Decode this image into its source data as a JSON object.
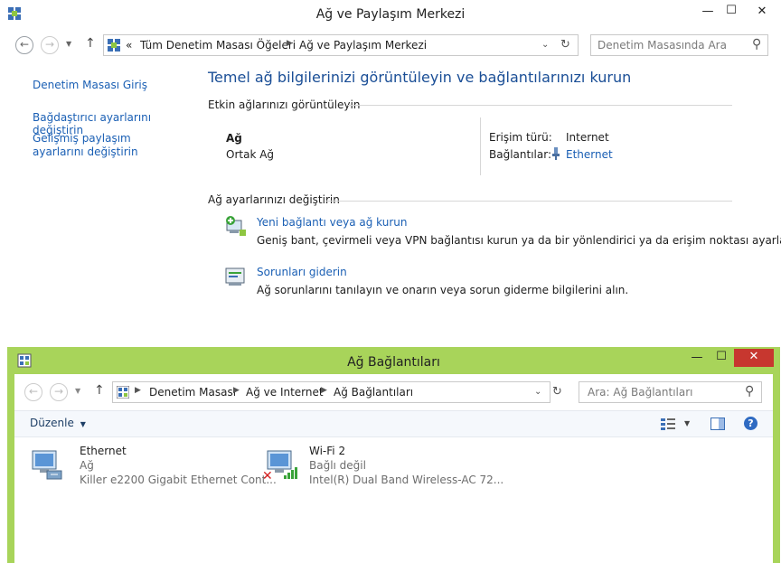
{
  "window1": {
    "title": "Ağ ve Paylaşım Merkezi",
    "controls": {
      "minimize": "—",
      "maximize": "☐",
      "close": "✕"
    },
    "breadcrumb": {
      "overflow": "«",
      "items": [
        "Tüm Denetim Masası Öğeleri",
        "Ağ ve Paylaşım Merkezi"
      ]
    },
    "search_placeholder": "Denetim Masasında Ara",
    "sidebar": {
      "home": "Denetim Masası Giriş",
      "items": [
        "Bağdaştırıcı ayarlarını değiştirin",
        "Gelişmiş paylaşım ayarlarını değiştirin"
      ]
    },
    "main": {
      "heading": "Temel ağ bilgilerinizi görüntüleyin ve bağlantılarınızı kurun",
      "active_section": "Etkin ağlarınızı görüntüleyin",
      "network_name": "Ağ",
      "network_type": "Ortak Ağ",
      "access_label": "Erişim türü:",
      "access_value": "Internet",
      "connections_label": "Bağlantılar:",
      "connections_value": "Ethernet",
      "change_section": "Ağ ayarlarınızı değiştirin",
      "tasks": [
        {
          "title": "Yeni bağlantı veya ağ kurun",
          "desc": "Geniş bant, çevirmeli veya VPN bağlantısı kurun ya da bir yönlendirici ya da erişim noktası ayarlayın."
        },
        {
          "title": "Sorunları giderin",
          "desc": "Ağ sorunlarını tanılayın ve onarın veya sorun giderme bilgilerini alın."
        }
      ]
    }
  },
  "window2": {
    "title": "Ağ Bağlantıları",
    "accent": "#a8d45a",
    "close_color": "#c7372f",
    "controls": {
      "minimize": "—",
      "maximize": "☐",
      "close": "✕"
    },
    "breadcrumb": {
      "items": [
        "Denetim Masası",
        "Ağ ve Internet",
        "Ağ Bağlantıları"
      ]
    },
    "search_placeholder": "Ara: Ağ Bağlantıları",
    "toolbar": {
      "organize": "Düzenle"
    },
    "adapters": [
      {
        "name": "Ethernet",
        "status": "Ağ",
        "device": "Killer e2200 Gigabit Ethernet Cont...",
        "icon": "ethernet-adapter-icon"
      },
      {
        "name": "Wi-Fi 2",
        "status": "Bağlı değil",
        "device": "Intel(R) Dual Band Wireless-AC 72...",
        "icon": "wifi-adapter-icon"
      }
    ]
  }
}
